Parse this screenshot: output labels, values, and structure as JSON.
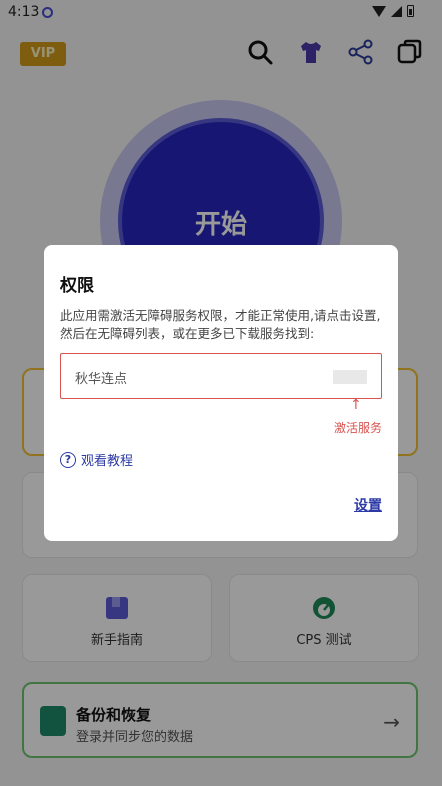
{
  "status_bar": {
    "time": "4:13"
  },
  "top_bar": {
    "vip_label": "VIP"
  },
  "start": {
    "label": "开始"
  },
  "cards": {
    "guide_label": "新手指南",
    "cps_label": "CPS 测试",
    "backup_title": "备份和恢复",
    "backup_subtitle": "登录并同步您的数据"
  },
  "dialog": {
    "title": "权限",
    "body": "此应用需激活无障碍服务权限，才能正常使用,请点击设置,然后在无障碍列表，或在更多已下载服务找到:",
    "service_name": "秋华连点",
    "arrow": "↑",
    "activate_label": "激活服务",
    "help_link": "观看教程",
    "help_icon_glyph": "?",
    "settings_label": "设置"
  },
  "arrow_glyph": "→",
  "colors": {
    "accent": "#2727c0",
    "error": "#d9534f",
    "link": "#2b3aa6",
    "vip": "#d39b1a"
  }
}
